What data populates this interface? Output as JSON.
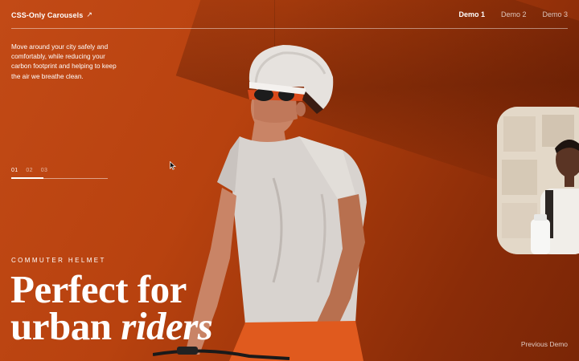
{
  "header": {
    "logo_text": "CSS-Only Carousels",
    "logo_arrow": "↗",
    "nav": [
      "Demo 1",
      "Demo 2",
      "Demo 3"
    ],
    "active_nav": "Demo 1"
  },
  "intro": {
    "text": "Move around your city safely and comfortably, while reducing your carbon footprint and helping to keep the air we breathe clean."
  },
  "pager": {
    "items": [
      "01",
      "02",
      "03"
    ],
    "active": "01",
    "progress": 0.33
  },
  "hero": {
    "eyebrow": "COMMUTER HELMET",
    "headline_line1": "Perfect for",
    "headline_line2_plain": "urban ",
    "headline_line2_italic": "riders"
  },
  "footer": {
    "previous_label": "Previous Demo"
  },
  "colors": {
    "background": "#b8420f",
    "text": "#ffffff",
    "card": "#e6dccd"
  },
  "icons": {
    "cursor": "mouse-pointer-icon",
    "logo_arrow": "arrow-up-right-icon"
  }
}
